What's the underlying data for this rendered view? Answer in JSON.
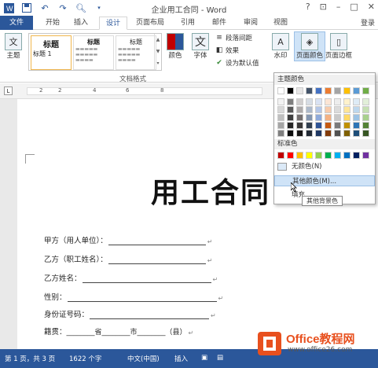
{
  "window": {
    "title": "企业用工合同 - Word",
    "help": "?",
    "login": "登录"
  },
  "qat": {
    "icons": [
      "word-logo-icon",
      "save-icon",
      "undo-icon",
      "redo-icon",
      "preview-icon",
      "customize-icon"
    ]
  },
  "tabs": [
    {
      "label": "文件"
    },
    {
      "label": "开始"
    },
    {
      "label": "插入"
    },
    {
      "label": "设计"
    },
    {
      "label": "页面布局"
    },
    {
      "label": "引用"
    },
    {
      "label": "邮件"
    },
    {
      "label": "审阅"
    },
    {
      "label": "视图"
    }
  ],
  "ribbon": {
    "theme_label": "主题",
    "styles": [
      {
        "head": "标题",
        "sub": "标题 1"
      },
      {
        "head": "标题",
        "sub": ""
      },
      {
        "head": "标题",
        "sub": ""
      }
    ],
    "group_label": "文档格式",
    "colors_label": "颜色",
    "fonts_label": "字体",
    "paragraph_spacing": "段落间距",
    "effects": "效果",
    "set_default": "设为默认值",
    "watermark": "水印",
    "page_color": "页面颜色",
    "page_border": "页面边框"
  },
  "ruler": {
    "tab_selector": "L",
    "numbers": [
      "2",
      "2",
      "4",
      "6",
      "8"
    ]
  },
  "document": {
    "title": "用工合同",
    "fields": [
      {
        "label": "甲方（用人单位）："
      },
      {
        "label": "乙方（职工姓名）："
      },
      {
        "label": "乙方姓名："
      },
      {
        "label": "性别："
      },
      {
        "label": "身份证号码："
      },
      {
        "label": "籍贯：",
        "rest": "________省________市________（县）"
      }
    ]
  },
  "color_panel": {
    "theme_header": "主题颜色",
    "standard_header": "标准色",
    "no_color": "无颜色(N)",
    "more_colors": "其他颜色(M)...",
    "fill": "填充",
    "tooltip": "其他背景色",
    "theme_rows": [
      [
        "#ffffff",
        "#000000",
        "#e7e6e6",
        "#44546a",
        "#4472c4",
        "#ed7d31",
        "#a5a5a5",
        "#ffc000",
        "#5b9bd5",
        "#70ad47"
      ],
      [
        "#f2f2f2",
        "#7f7f7f",
        "#d0cece",
        "#d6dce4",
        "#d9e2f3",
        "#fbe5d5",
        "#ededed",
        "#fff2cc",
        "#deebf6",
        "#e2efd9"
      ],
      [
        "#d8d8d8",
        "#595959",
        "#aeabab",
        "#adb9ca",
        "#b4c6e7",
        "#f7cbac",
        "#dbdbdb",
        "#fee599",
        "#bdd7ee",
        "#c5e0b3"
      ],
      [
        "#bfbfbf",
        "#3f3f3f",
        "#757070",
        "#8496b0",
        "#8eaadb",
        "#f4b183",
        "#c9c9c9",
        "#ffd965",
        "#9cc3e5",
        "#a8d08d"
      ],
      [
        "#a5a5a5",
        "#262626",
        "#3a3838",
        "#323f4f",
        "#2f5496",
        "#c55a11",
        "#7b7b7b",
        "#bf9000",
        "#2e75b5",
        "#538135"
      ],
      [
        "#7f7f7f",
        "#0c0c0c",
        "#171616",
        "#222a35",
        "#1f3864",
        "#833c0b",
        "#525252",
        "#7f6000",
        "#1e4e79",
        "#375623"
      ]
    ],
    "standard": [
      "#c00000",
      "#ff0000",
      "#ffc000",
      "#ffff00",
      "#92d050",
      "#00b050",
      "#00b0f0",
      "#0070c0",
      "#002060",
      "#7030a0"
    ]
  },
  "status": {
    "page": "第 1 页，共 3 页",
    "words": "1622 个字",
    "lang": "中文(中国)",
    "mode": "插入"
  },
  "watermark": {
    "text": "Office教程网",
    "url": "www.office26.com"
  }
}
